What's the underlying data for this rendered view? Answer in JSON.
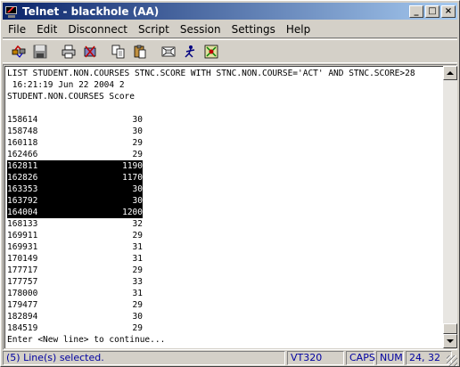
{
  "window": {
    "title": "Telnet - blackhole (AA)",
    "buttons": {
      "minimize": "_",
      "maximize": "□",
      "close": "×"
    }
  },
  "menu": [
    "File",
    "Edit",
    "Disconnect",
    "Script",
    "Session",
    "Settings",
    "Help"
  ],
  "toolbar": {
    "icons": [
      "connect-icon",
      "save-icon",
      "print-icon",
      "settings-icon",
      "copy-icon",
      "paste-icon",
      "transfer-icon",
      "run-script-icon",
      "tools-icon"
    ]
  },
  "terminal": {
    "command": "LIST STUDENT.NON.COURSES STNC.SCORE WITH STNC.NON.COURSE='ACT' AND STNC.SCORE>28",
    "timestamp_line": " 16:21:19 Jun 22 2004 2",
    "header": "STUDENT.NON.COURSES Score",
    "rows": [
      {
        "id": "158614",
        "score": "30",
        "selected": false
      },
      {
        "id": "158748",
        "score": "30",
        "selected": false
      },
      {
        "id": "160118",
        "score": "29",
        "selected": false
      },
      {
        "id": "162466",
        "score": "29",
        "selected": false
      },
      {
        "id": "162811",
        "score": "1190",
        "selected": true
      },
      {
        "id": "162826",
        "score": "1170",
        "selected": true
      },
      {
        "id": "163353",
        "score": "30",
        "selected": true
      },
      {
        "id": "163792",
        "score": "30",
        "selected": true
      },
      {
        "id": "164004",
        "score": "1200",
        "selected": true
      },
      {
        "id": "168133",
        "score": "32",
        "selected": false
      },
      {
        "id": "169911",
        "score": "29",
        "selected": false
      },
      {
        "id": "169931",
        "score": "31",
        "selected": false
      },
      {
        "id": "170149",
        "score": "31",
        "selected": false
      },
      {
        "id": "177717",
        "score": "29",
        "selected": false
      },
      {
        "id": "177757",
        "score": "33",
        "selected": false
      },
      {
        "id": "178000",
        "score": "31",
        "selected": false
      },
      {
        "id": "179477",
        "score": "29",
        "selected": false
      },
      {
        "id": "182894",
        "score": "30",
        "selected": false
      },
      {
        "id": "184519",
        "score": "29",
        "selected": false
      }
    ],
    "prompt": "Enter <New line> to continue..."
  },
  "status": {
    "selection": "(5) Line(s) selected.",
    "emulation": "VT320",
    "caps": "CAPS",
    "num": "NUM",
    "cursor": "24, 32"
  },
  "colors": {
    "titlebar_start": "#0a246a",
    "titlebar_end": "#a6caf0",
    "selection_bg": "#000000",
    "status_text": "#0000a0"
  }
}
